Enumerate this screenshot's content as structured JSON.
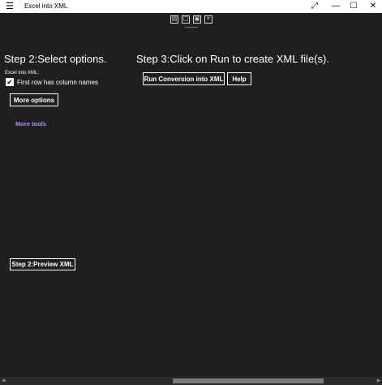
{
  "window": {
    "title": "Excel into XML",
    "menu_icon": "hamburger-icon",
    "controls": {
      "expand_icon": "expand-icon",
      "minimize_icon": "minimize-icon",
      "maximize_icon": "maximize-icon",
      "close_icon": "close-icon"
    }
  },
  "toolbar": {
    "icons": [
      "select-icon",
      "comment-icon",
      "screen-icon",
      "crop-icon"
    ]
  },
  "step2": {
    "heading": "Step 2:Select options.",
    "group_label": "Excel Into XML:",
    "checkbox_label": "First row has column names",
    "checkbox_checked": true,
    "more_options_label": "More options",
    "more_tools_label": "More tools",
    "preview_label": "Step 2:Preview XML"
  },
  "step3": {
    "heading": "Step 3:Click on Run to create XML file(s).",
    "run_label": "Run Conversion into XML",
    "help_label": "Help"
  },
  "colors": {
    "background": "#1f1f1f",
    "titlebar": "#ffffff",
    "link": "#b48cff",
    "text": "#ffffff"
  }
}
